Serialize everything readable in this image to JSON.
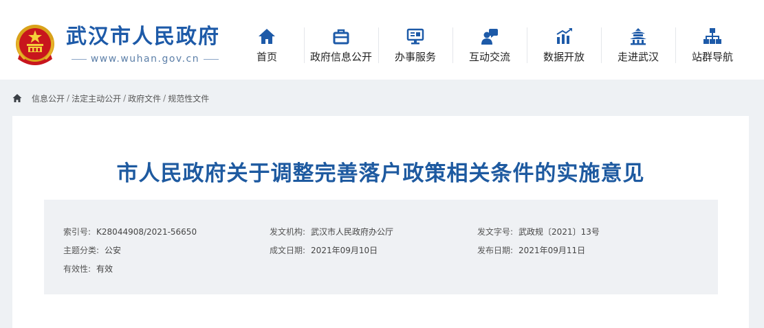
{
  "header": {
    "site_name": "武汉市人民政府",
    "site_url": "www.wuhan.gov.cn",
    "emblem_icon": "national-emblem-icon"
  },
  "nav": {
    "items": [
      {
        "label": "首页",
        "icon": "home-icon"
      },
      {
        "label": "政府信息公开",
        "icon": "briefcase-icon"
      },
      {
        "label": "办事服务",
        "icon": "monitor-icon"
      },
      {
        "label": "互动交流",
        "icon": "chat-user-icon"
      },
      {
        "label": "数据开放",
        "icon": "bar-chart-icon"
      },
      {
        "label": "走进武汉",
        "icon": "pavilion-icon"
      },
      {
        "label": "站群导航",
        "icon": "sitemap-icon"
      }
    ]
  },
  "breadcrumb": {
    "items": [
      "信息公开",
      "法定主动公开",
      "政府文件",
      "规范性文件"
    ],
    "separator": "/"
  },
  "article": {
    "title": "市人民政府关于调整完善落户政策相关条件的实施意见",
    "meta": {
      "index_no": {
        "label": "索引号:",
        "value": "K28044908/2021-56650"
      },
      "issuer": {
        "label": "发文机构:",
        "value": "武汉市人民政府办公厅"
      },
      "doc_no": {
        "label": "发文字号:",
        "value": "武政规〔2021〕13号"
      },
      "category": {
        "label": "主题分类:",
        "value": "公安"
      },
      "written_date": {
        "label": "成文日期:",
        "value": "2021年09月10日"
      },
      "publish_date": {
        "label": "发布日期:",
        "value": "2021年09月11日"
      },
      "validity": {
        "label": "有效性:",
        "value": "有效"
      }
    }
  },
  "colors": {
    "brand_blue": "#1d5aa8",
    "title_blue": "#1e5aa0",
    "page_bg": "#eef1f4",
    "meta_bg": "#eff1f4"
  }
}
